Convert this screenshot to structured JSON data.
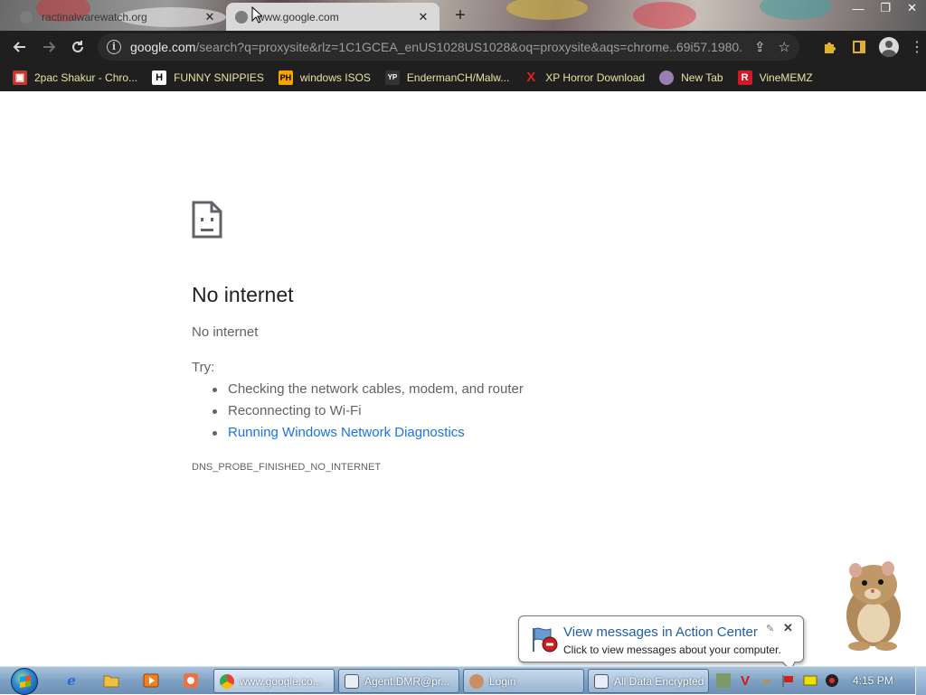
{
  "browser": {
    "tabs": [
      {
        "title": "ractinalwarewatch.org",
        "active": false
      },
      {
        "title": "www.google.com",
        "active": true
      }
    ],
    "new_tab_icon": "plus-icon",
    "window_controls": [
      "minimize",
      "maximize",
      "close"
    ],
    "address": {
      "host": "google.com",
      "path": "/search?q=proxysite&rlz=1C1GCEA_enUS1028US1028&oq=proxysite&aqs=chrome..69i57.1980..."
    },
    "bookmarks": [
      {
        "label": "2pac Shakur - Chro...",
        "icon": "bookmark-icon-2pac",
        "color": "#c0392b"
      },
      {
        "label": "FUNNY SNIPPIES",
        "icon": "H",
        "color": "#ffffff"
      },
      {
        "label": "windows ISOS",
        "icon": "PH",
        "color": "#f7a400"
      },
      {
        "label": "EndermanCH/Malw...",
        "icon": "YP",
        "color": "#333333"
      },
      {
        "label": "XP Horror Download",
        "icon": "X",
        "color": "#e02020"
      },
      {
        "label": "New Tab",
        "icon": "globe-icon",
        "color": "#9a7fb0"
      },
      {
        "label": "VineMEMZ",
        "icon": "R",
        "color": "#d01a2a"
      }
    ]
  },
  "error_page": {
    "title": "No internet",
    "subtitle": "No internet",
    "try_label": "Try:",
    "suggestions": [
      {
        "text": "Checking the network cables, modem, and router",
        "link": false
      },
      {
        "text": "Reconnecting to Wi-Fi",
        "link": false
      },
      {
        "text": "Running Windows Network Diagnostics",
        "link": true
      }
    ],
    "error_code": "DNS_PROBE_FINISHED_NO_INTERNET"
  },
  "notification": {
    "title": "View messages in Action Center",
    "text": "Click to view messages about your computer."
  },
  "taskbar": {
    "windows": [
      {
        "label": "www.google.co...",
        "icon": "chrome-icon",
        "active": true
      },
      {
        "label": "Agent.DMR@pr...",
        "icon": "window-icon",
        "active": false
      },
      {
        "label": "Login",
        "icon": "user-icon",
        "active": false
      },
      {
        "label": "All Data Encrypted",
        "icon": "window-icon",
        "active": false
      }
    ],
    "clock": "4:15 PM"
  },
  "colors": {
    "link": "#1a73e8",
    "toolbar": "#1f1f1f",
    "bookmark_text": "#e8e4a0",
    "balloon_title": "#1e5fa8"
  }
}
